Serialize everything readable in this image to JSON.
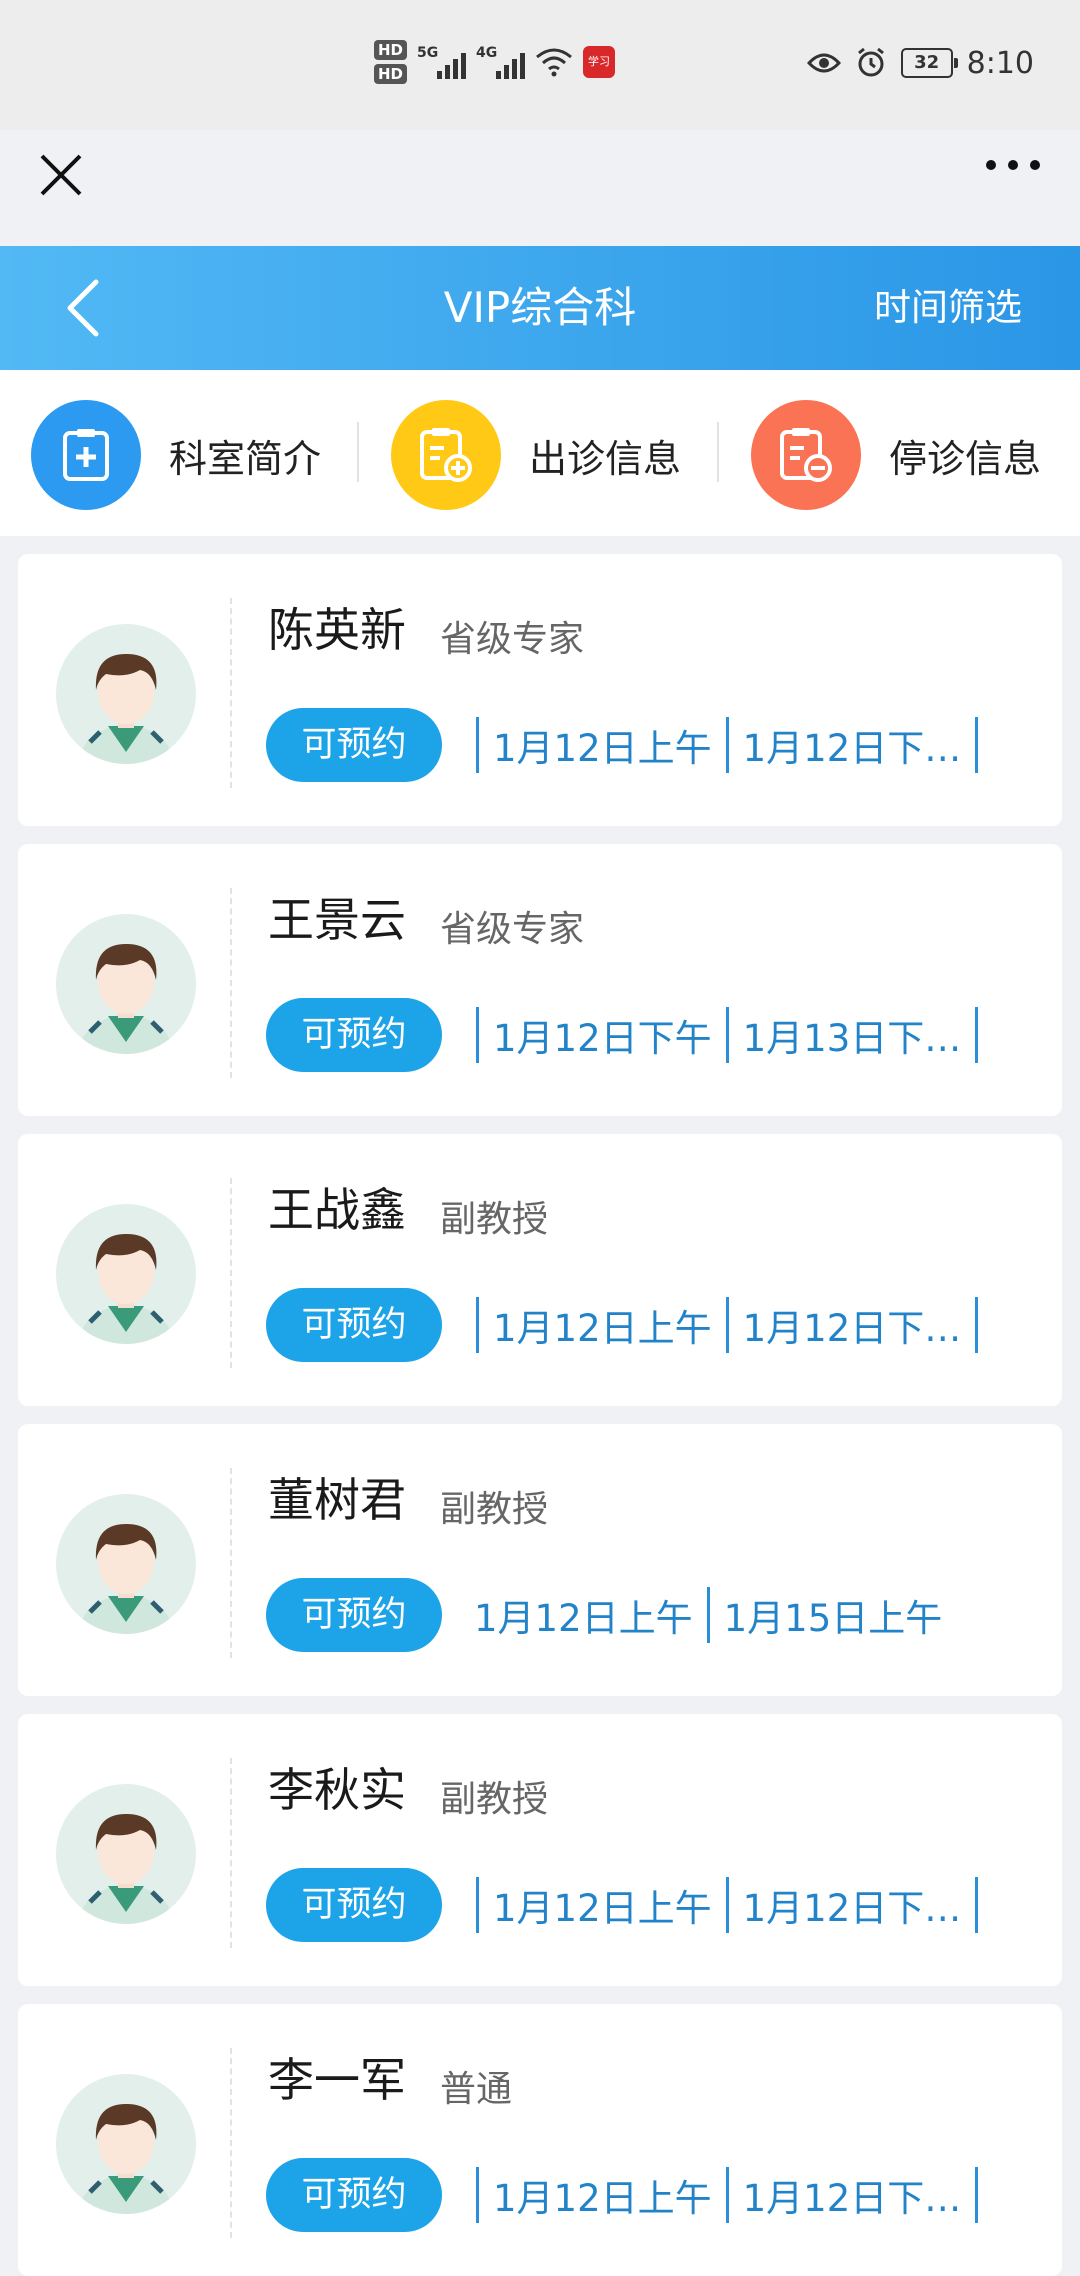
{
  "status_bar": {
    "hd1": "HD",
    "hd2": "HD",
    "net1": "5G",
    "net2": "4G",
    "app_icon_text": "学习",
    "battery": "32",
    "battery_level_percent": 32,
    "time": "8:10"
  },
  "header": {
    "title": "VIP综合科",
    "filter": "时间筛选"
  },
  "quick_nav": [
    {
      "label": "科室简介",
      "color": "#2b9af0",
      "icon": "clipboard-plus-icon"
    },
    {
      "label": "出诊信息",
      "color": "#ffc915",
      "icon": "clipboard-add-icon"
    },
    {
      "label": "停诊信息",
      "color": "#fb7355",
      "icon": "clipboard-minus-icon"
    }
  ],
  "doctors": [
    {
      "name": "陈英新",
      "title": "省级专家",
      "status": "可预约",
      "slots": [
        "1月12日上午",
        "1月12日下…"
      ]
    },
    {
      "name": "王景云",
      "title": "省级专家",
      "status": "可预约",
      "slots": [
        "1月12日下午",
        "1月13日下…"
      ]
    },
    {
      "name": "王战鑫",
      "title": "副教授",
      "status": "可预约",
      "slots": [
        "1月12日上午",
        "1月12日下…"
      ]
    },
    {
      "name": "董树君",
      "title": "副教授",
      "status": "可预约",
      "slots": [
        "1月12日上午",
        "1月15日上午"
      ]
    },
    {
      "name": "李秋实",
      "title": "副教授",
      "status": "可预约",
      "slots": [
        "1月12日上午",
        "1月12日下…"
      ]
    },
    {
      "name": "李一军",
      "title": "普通",
      "status": "可预约",
      "slots": [
        "1月12日上午",
        "1月12日下…"
      ]
    }
  ]
}
